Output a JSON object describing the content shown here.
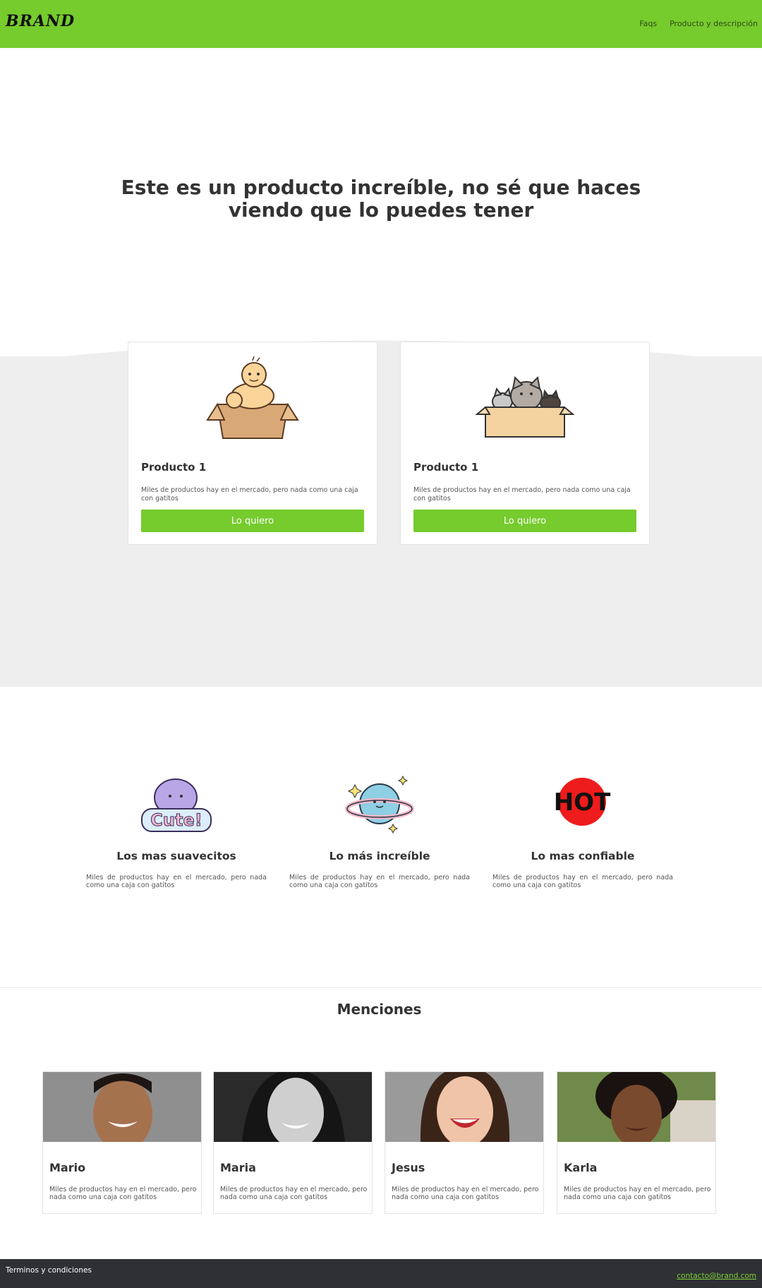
{
  "header": {
    "brand": "BRAND",
    "nav": [
      "Faqs",
      "Producto y descripción"
    ],
    "background": "#76cb2d"
  },
  "hero": {
    "title": "Este es un producto increíble, no sé que haces viendo que lo puedes tener"
  },
  "products": [
    {
      "title": "Producto 1",
      "description": "Miles de productos hay en el mercado, pero nada como una caja con gatitos",
      "button": "Lo quiero",
      "icon": "baby-in-box-icon"
    },
    {
      "title": "Producto 1",
      "description": "Miles de productos hay en el mercado, pero nada como una caja con gatitos",
      "button": "Lo quiero",
      "icon": "cats-in-box-icon"
    }
  ],
  "features": [
    {
      "title": "Los mas suavecitos",
      "description": "Miles de productos hay en el mercado, pero nada como una caja con gatitos",
      "icon": "cute-sticker-icon",
      "sticker_text": "Cute!"
    },
    {
      "title": "Lo más increíble",
      "description": "Miles de productos hay en el mercado, pero nada como una caja con gatitos",
      "icon": "planet-icon"
    },
    {
      "title": "Lo mas confiable",
      "description": "Miles de productos hay en el mercado, pero nada como una caja con gatitos",
      "icon": "hot-sticker-icon",
      "sticker_text": "HOT"
    }
  ],
  "mentions": {
    "title": "Menciones",
    "people": [
      {
        "name": "Mario",
        "description": "Miles de productos hay en el mercado, pero nada como una caja con gatitos"
      },
      {
        "name": "Maria",
        "description": "Miles de productos hay en el mercado, pero nada como una caja con gatitos"
      },
      {
        "name": "Jesus",
        "description": "Miles de productos hay en el mercado, pero nada como una caja con gatitos"
      },
      {
        "name": "Karla",
        "description": "Miles de productos hay en el mercado, pero nada como una caja con gatitos"
      }
    ]
  },
  "footer": {
    "terms": "Terminos y condiciones",
    "email": "contacto@brand.com",
    "background": "#2f3033"
  }
}
